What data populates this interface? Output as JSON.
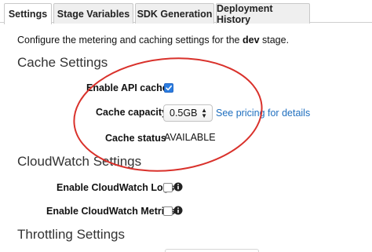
{
  "tabs": [
    {
      "label": "Settings",
      "active": true
    },
    {
      "label": "Stage Variables",
      "active": false
    },
    {
      "label": "SDK Generation",
      "active": false
    },
    {
      "label": "Deployment History",
      "active": false
    }
  ],
  "intro": {
    "prefix": "Configure the metering and caching settings for the ",
    "stage": "dev",
    "suffix": " stage."
  },
  "cache_settings": {
    "title": "Cache Settings",
    "enable_api_cache": {
      "label": "Enable API cache",
      "checked": true
    },
    "cache_capacity": {
      "label": "Cache capacity",
      "selected": "0.5GB",
      "pricing_link": "See pricing for details"
    },
    "cache_status": {
      "label": "Cache status",
      "value": "AVAILABLE"
    }
  },
  "cloudwatch_settings": {
    "title": "CloudWatch Settings",
    "enable_logs": {
      "label": "Enable CloudWatch Logs",
      "checked": false,
      "icon": "info-icon"
    },
    "enable_metrics": {
      "label": "Enable CloudWatch Metrics",
      "checked": false,
      "icon": "info-icon"
    }
  },
  "throttling_settings": {
    "title": "Throttling Settings"
  },
  "annotation": {
    "shape": "ellipse",
    "color": "#d9312b"
  },
  "colors": {
    "link": "#1f6fbf",
    "checkbox_checked": "#2b7de1",
    "annotation": "#d9312b"
  }
}
